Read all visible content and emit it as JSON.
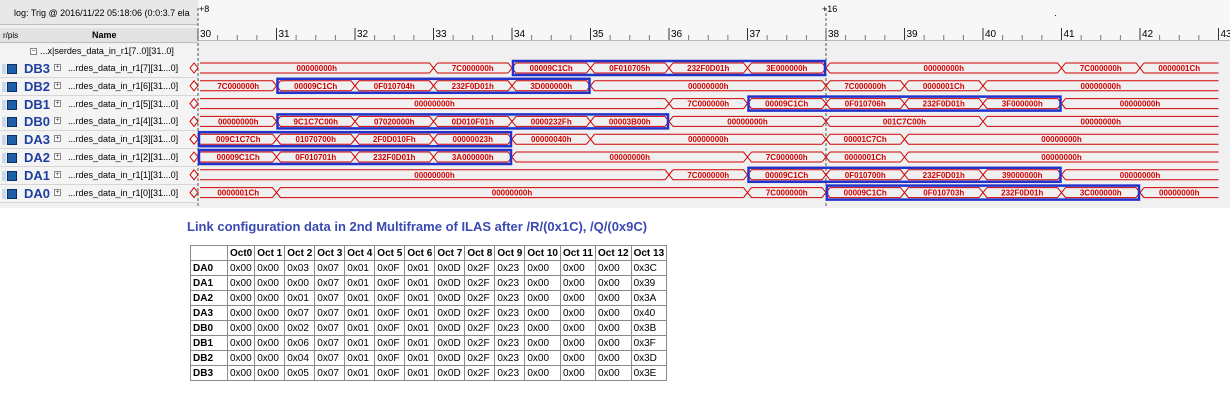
{
  "waveform": {
    "status_text": "log: Trig @ 2016/11/22 05:18:06 (0:0:3.7 ela",
    "marker_left": "+8",
    "marker_right": "+16",
    "dot": "·",
    "col_short": "r/pis",
    "col_name": "Name",
    "ticks": [
      "30",
      "31",
      "32",
      "33",
      "34",
      "35",
      "36",
      "37",
      "38",
      "39",
      "40",
      "41",
      "42",
      "43"
    ],
    "top_row": "...x|serdes_data_in_r1[7..0][31..0]",
    "rows": [
      {
        "id": "DB3",
        "signal": "...rdes_data_in_r1[7][31...0]"
      },
      {
        "id": "DB2",
        "signal": "...rdes_data_in_r1[6][31...0]"
      },
      {
        "id": "DB1",
        "signal": "...rdes_data_in_r1[5][31...0]"
      },
      {
        "id": "DB0",
        "signal": "...rdes_data_in_r1[4][31...0]"
      },
      {
        "id": "DA3",
        "signal": "...rdes_data_in_r1[3][31...0]"
      },
      {
        "id": "DA2",
        "signal": "...rdes_data_in_r1[2][31...0]"
      },
      {
        "id": "DA1",
        "signal": "...rdes_data_in_r1[1][31...0]"
      },
      {
        "id": "DA0",
        "signal": "...rdes_data_in_r1[0][31...0]"
      }
    ],
    "segments": [
      [
        [
          "00000000h",
          30,
          33
        ],
        [
          "7C000000h",
          33,
          34
        ],
        [
          "00009C1Ch",
          34,
          35
        ],
        [
          "0F010705h",
          35,
          36
        ],
        [
          "232F0D01h",
          36,
          37
        ],
        [
          "3E000000h",
          37,
          38
        ],
        [
          "00000000h",
          38,
          41
        ],
        [
          "7C000000h",
          41,
          42
        ],
        [
          "0000001Ch",
          42,
          43
        ]
      ],
      [
        [
          "7C000000h",
          30,
          31
        ],
        [
          "00009C1Ch",
          31,
          32
        ],
        [
          "0F010704h",
          32,
          33
        ],
        [
          "232F0D01h",
          33,
          34
        ],
        [
          "3D000000h",
          34,
          35
        ],
        [
          "00000000h",
          35,
          38
        ],
        [
          "7C000000h",
          38,
          39
        ],
        [
          "0000001Ch",
          39,
          40
        ],
        [
          "00000000h",
          40,
          43
        ]
      ],
      [
        [
          "00000000h",
          30,
          36
        ],
        [
          "7C000000h",
          36,
          37
        ],
        [
          "00009C1Ch",
          37,
          38
        ],
        [
          "0F010706h",
          38,
          39
        ],
        [
          "232F0D01h",
          39,
          40
        ],
        [
          "3F000000h",
          40,
          41
        ],
        [
          "00000000h",
          41,
          43
        ]
      ],
      [
        [
          "00000000h",
          30,
          31
        ],
        [
          "9C1C7C00h",
          31,
          32
        ],
        [
          "07020000h",
          32,
          33
        ],
        [
          "0D010F01h",
          33,
          34
        ],
        [
          "0000232Fh",
          34,
          35
        ],
        [
          "00003B00h",
          35,
          36
        ],
        [
          "00000000h",
          36,
          38
        ],
        [
          "001C7C00h",
          38,
          40
        ],
        [
          "00000000h",
          40,
          43
        ]
      ],
      [
        [
          "009C1C7Ch",
          30,
          31
        ],
        [
          "01070700h",
          31,
          32
        ],
        [
          "2F0D010Fh",
          32,
          33
        ],
        [
          "00000023h",
          33,
          34
        ],
        [
          "00000040h",
          34,
          35
        ],
        [
          "00000000h",
          35,
          38
        ],
        [
          "00001C7Ch",
          38,
          39
        ],
        [
          "00000000h",
          39,
          43
        ]
      ],
      [
        [
          "00009C1Ch",
          30,
          31
        ],
        [
          "0F010701h",
          31,
          32
        ],
        [
          "232F0D01h",
          32,
          33
        ],
        [
          "3A000000h",
          33,
          34
        ],
        [
          "00000000h",
          34,
          37
        ],
        [
          "7C000000h",
          37,
          38
        ],
        [
          "0000001Ch",
          38,
          39
        ],
        [
          "00000000h",
          39,
          43
        ]
      ],
      [
        [
          "00000000h",
          30,
          36
        ],
        [
          "7C000000h",
          36,
          37
        ],
        [
          "00009C1Ch",
          37,
          38
        ],
        [
          "0F010700h",
          38,
          39
        ],
        [
          "232F0D01h",
          39,
          40
        ],
        [
          "39000000h",
          40,
          41
        ],
        [
          "00000000h",
          41,
          43
        ]
      ],
      [
        [
          "0000001Ch",
          30,
          31
        ],
        [
          "00000000h",
          31,
          37
        ],
        [
          "7C000000h",
          37,
          38
        ],
        [
          "00009C1Ch",
          38,
          39
        ],
        [
          "0F010703h",
          39,
          40
        ],
        [
          "232F0D01h",
          40,
          41
        ],
        [
          "3C000000h",
          41,
          42
        ],
        [
          "00000000h",
          42,
          43
        ]
      ]
    ],
    "highlights": [
      [
        34,
        38
      ],
      [
        31,
        35
      ],
      [
        37,
        41
      ],
      [
        31,
        36
      ],
      [
        30,
        34
      ],
      [
        30,
        34
      ],
      [
        37,
        41
      ],
      [
        38,
        42
      ]
    ],
    "colors": {
      "wave": "#d00000",
      "highlight": "#2233cc",
      "label": "#1f3fa0",
      "background": "#f0f0f0"
    }
  },
  "ilas": {
    "caption": "Link configuration data in 2nd Multiframe of ILAS after /R/(0x1C), /Q/(0x9C)",
    "headers": [
      "",
      "Oct0",
      "Oct 1",
      "Oct 2",
      "Oct 3",
      "Oct 4",
      "Oct 5",
      "Oct 6",
      "Oct 7",
      "Oct 8",
      "Oct 9",
      "Oct 10",
      "Oct 11",
      "Oct 12",
      "Oct 13"
    ],
    "rows": [
      [
        "DA0",
        "0x00",
        "0x00",
        "0x03",
        "0x07",
        "0x01",
        "0x0F",
        "0x01",
        "0x0D",
        "0x2F",
        "0x23",
        "0x00",
        "0x00",
        "0x00",
        "0x3C"
      ],
      [
        "DA1",
        "0x00",
        "0x00",
        "0x00",
        "0x07",
        "0x01",
        "0x0F",
        "0x01",
        "0x0D",
        "0x2F",
        "0x23",
        "0x00",
        "0x00",
        "0x00",
        "0x39"
      ],
      [
        "DA2",
        "0x00",
        "0x00",
        "0x01",
        "0x07",
        "0x01",
        "0x0F",
        "0x01",
        "0x0D",
        "0x2F",
        "0x23",
        "0x00",
        "0x00",
        "0x00",
        "0x3A"
      ],
      [
        "DA3",
        "0x00",
        "0x00",
        "0x07",
        "0x07",
        "0x01",
        "0x0F",
        "0x01",
        "0x0D",
        "0x2F",
        "0x23",
        "0x00",
        "0x00",
        "0x00",
        "0x40"
      ],
      [
        "DB0",
        "0x00",
        "0x00",
        "0x02",
        "0x07",
        "0x01",
        "0x0F",
        "0x01",
        "0x0D",
        "0x2F",
        "0x23",
        "0x00",
        "0x00",
        "0x00",
        "0x3B"
      ],
      [
        "DB1",
        "0x00",
        "0x00",
        "0x06",
        "0x07",
        "0x01",
        "0x0F",
        "0x01",
        "0x0D",
        "0x2F",
        "0x23",
        "0x00",
        "0x00",
        "0x00",
        "0x3F"
      ],
      [
        "DB2",
        "0x00",
        "0x00",
        "0x04",
        "0x07",
        "0x01",
        "0x0F",
        "0x01",
        "0x0D",
        "0x2F",
        "0x23",
        "0x00",
        "0x00",
        "0x00",
        "0x3D"
      ],
      [
        "DB3",
        "0x00",
        "0x00",
        "0x05",
        "0x07",
        "0x01",
        "0x0F",
        "0x01",
        "0x0D",
        "0x2F",
        "0x23",
        "0x00",
        "0x00",
        "0x00",
        "0x3E"
      ]
    ]
  }
}
